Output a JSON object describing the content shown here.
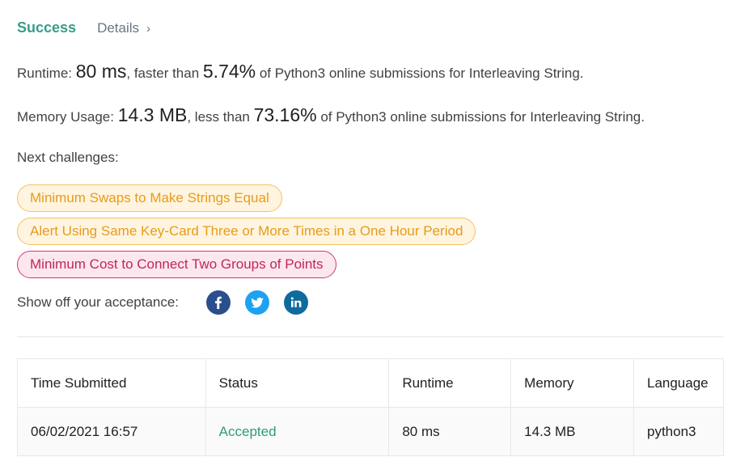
{
  "header": {
    "status": "Success",
    "details_label": "Details",
    "details_chevron": "›"
  },
  "runtime_line": {
    "prefix": "Runtime: ",
    "value": "80 ms",
    "middle": ", faster than ",
    "percent": "5.74%",
    "suffix": " of Python3 online submissions for Interleaving String."
  },
  "memory_line": {
    "prefix": "Memory Usage: ",
    "value": "14.3 MB",
    "middle": ", less than ",
    "percent": "73.16%",
    "suffix": " of Python3 online submissions for Interleaving String."
  },
  "next_challenges": {
    "label": "Next challenges:",
    "items": [
      {
        "title": "Minimum Swaps to Make Strings Equal",
        "difficulty": "medium"
      },
      {
        "title": "Alert Using Same Key-Card Three or More Times in a One Hour Period",
        "difficulty": "medium"
      },
      {
        "title": "Minimum Cost to Connect Two Groups of Points",
        "difficulty": "hard"
      }
    ]
  },
  "share": {
    "label": "Show off your acceptance:",
    "icons": [
      "facebook-icon",
      "twitter-icon",
      "linkedin-icon"
    ]
  },
  "submissions": {
    "columns": [
      "Time Submitted",
      "Status",
      "Runtime",
      "Memory",
      "Language"
    ],
    "rows": [
      {
        "time": "06/02/2021 16:57",
        "status": "Accepted",
        "runtime": "80 ms",
        "memory": "14.3 MB",
        "language": "python3"
      }
    ]
  },
  "colors": {
    "success": "#3a9b8a",
    "medium_text": "#e69c1a",
    "medium_bg": "#fff4e0",
    "hard_text": "#c0255c",
    "hard_bg": "#fde7ef",
    "accepted": "#2f9a7d",
    "facebook": "#2a4f8c",
    "twitter": "#1da1f2",
    "linkedin": "#0f6b9c"
  }
}
